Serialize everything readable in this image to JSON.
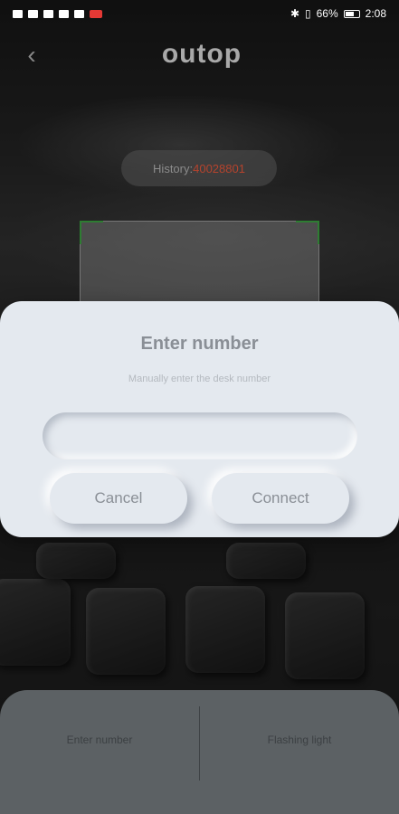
{
  "status_bar": {
    "battery": "66%",
    "time": "2:08"
  },
  "header": {
    "logo": "outop"
  },
  "history": {
    "label": "History:",
    "number": "40028801"
  },
  "dialog": {
    "title": "Enter number",
    "subtitle": "Manually enter the desk number",
    "input_value": "",
    "cancel_label": "Cancel",
    "connect_label": "Connect"
  },
  "bottom_bar": {
    "enter_number_label": "Enter number",
    "flashing_light_label": "Flashing light"
  }
}
